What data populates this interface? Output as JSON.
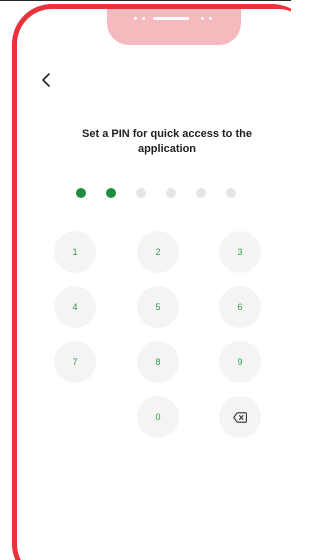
{
  "header": {
    "back_icon": "chevron-left-icon"
  },
  "main": {
    "title": "Set a PIN for quick access to the application",
    "pin": {
      "length": 6,
      "filled": 2
    },
    "keypad": {
      "keys": [
        "1",
        "2",
        "3",
        "4",
        "5",
        "6",
        "7",
        "8",
        "9",
        "0"
      ],
      "delete_icon": "backspace-icon"
    }
  },
  "colors": {
    "frame_border": "#e8323c",
    "frame_fill": "#f6b9bd",
    "accent": "#1e8d3e",
    "key_text": "#2e9a4e",
    "key_bg": "#f4f4f4",
    "dot_empty": "#e6e6e6"
  }
}
